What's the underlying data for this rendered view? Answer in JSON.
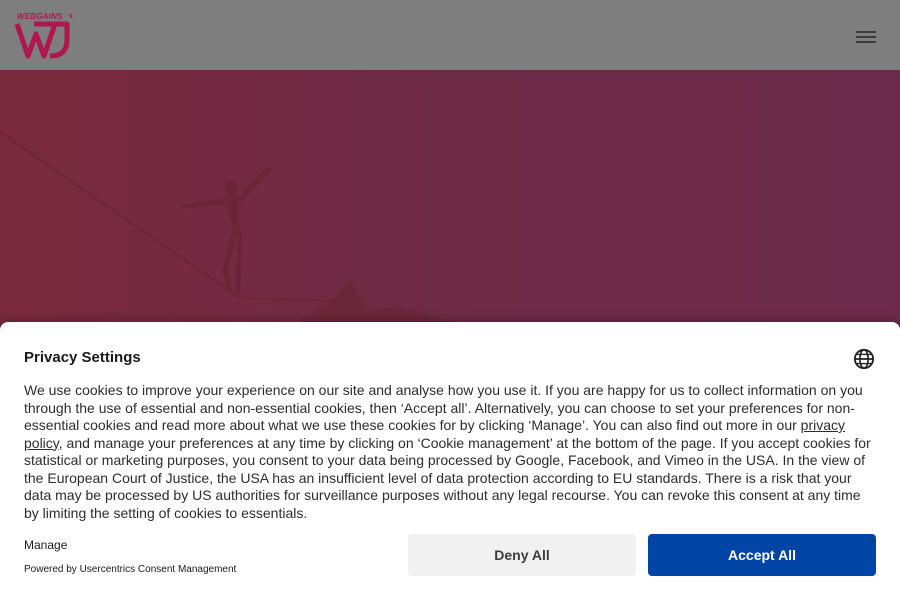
{
  "header": {
    "logo_text": "WEBGAINS",
    "menu_icon": "hamburger-icon"
  },
  "consent": {
    "title": "Privacy Settings",
    "language_icon": "globe-icon",
    "body_part1": "We use cookies to improve your experience on our site and analyse how you use it. If you are happy for us to collect information on you through the use of essential and non-essential cookies, then ‘Accept all’. Alternatively, you can choose to set your preferences for non-essential cookies and read more about what we use these cookies for by clicking ‘Manage’. You can also find out more in our ",
    "privacy_link": "privacy policy",
    "body_part2": ", and manage your preferences at any time by clicking on ‘Cookie management’ at the bottom of the page. If you accept cookies for statistical or marketing purposes, you consent to your data being processed by Google, Facebook, and Vimeo in the USA. In the view of the European Court of Justice, the USA has an insufficient level of data protection according to EU standards. There is a risk that your data may be processed by US authorities for surveillance purposes without any legal recourse. You can revoke this consent at any time by limiting the setting of cookies to essentials.",
    "manage_label": "Manage",
    "powered_by": "Powered by Usercentrics Consent Management",
    "deny_label": "Deny All",
    "accept_label": "Accept All"
  },
  "colors": {
    "accept": "#0045a5",
    "deny": "#f1f1f1",
    "brand": "#b0174f"
  }
}
